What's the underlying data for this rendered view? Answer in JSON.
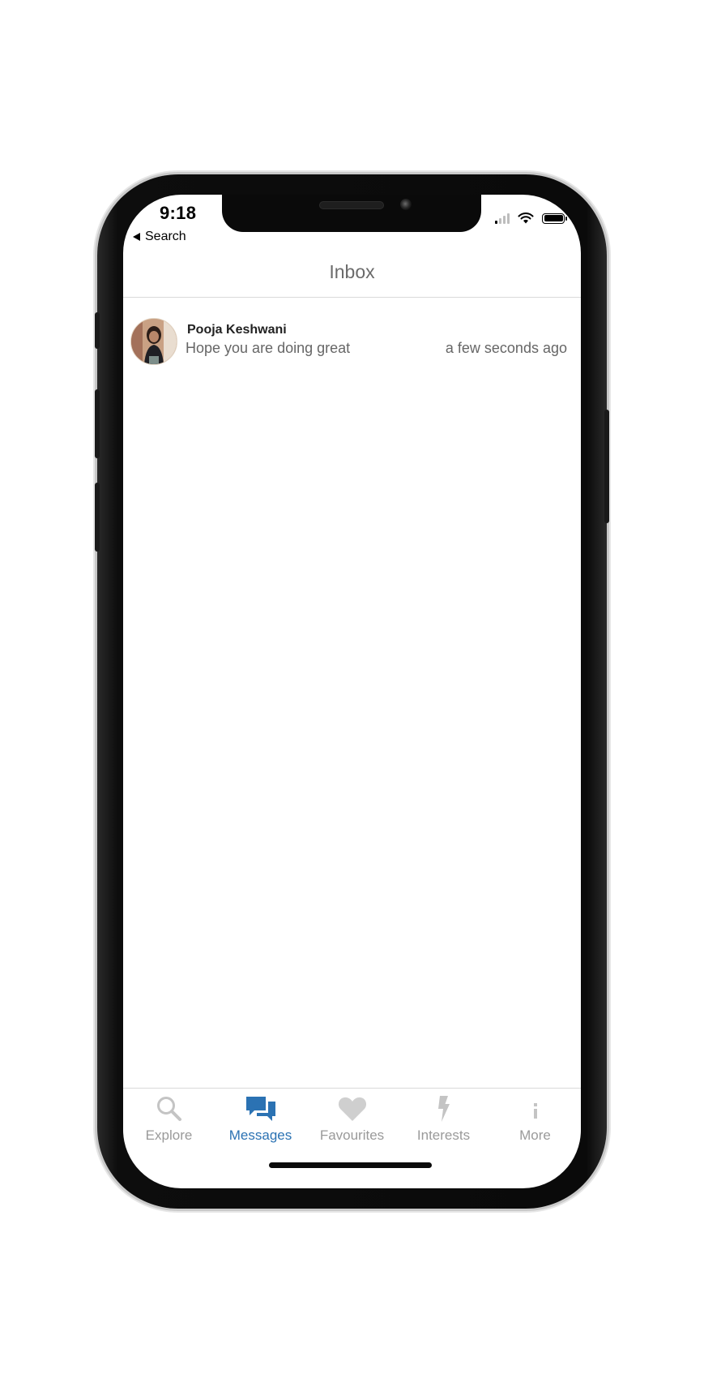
{
  "status_bar": {
    "time": "9:18",
    "back_label": "Search"
  },
  "header": {
    "title": "Inbox"
  },
  "conversations": [
    {
      "name": "Pooja Keshwani",
      "last_message": "Hope you are doing great",
      "time": "a few seconds ago"
    }
  ],
  "tabbar": {
    "active_color": "#2b72b3",
    "inactive_color": "#9a9a9a",
    "tabs": [
      {
        "label": "Explore",
        "icon": "search-icon",
        "active": false
      },
      {
        "label": "Messages",
        "icon": "chat-bubbles-icon",
        "active": true
      },
      {
        "label": "Favourites",
        "icon": "heart-icon",
        "active": false
      },
      {
        "label": "Interests",
        "icon": "lightning-icon",
        "active": false
      },
      {
        "label": "More",
        "icon": "info-icon",
        "active": false
      }
    ]
  }
}
